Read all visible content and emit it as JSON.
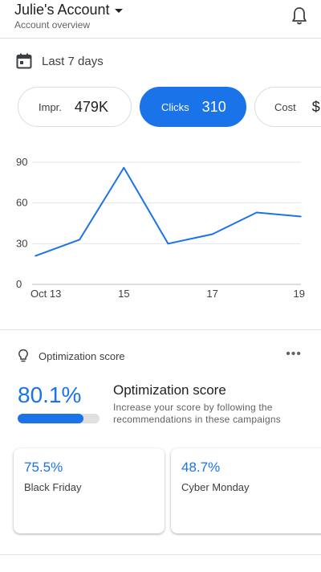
{
  "header": {
    "account_name": "Julie's Account",
    "account_sub": "Account overview",
    "bell_icon": "notifications-bell-icon"
  },
  "date_range": {
    "icon": "calendar-icon",
    "label": "Last 7 days"
  },
  "metrics": [
    {
      "label": "Impr.",
      "value": "479K",
      "selected": false
    },
    {
      "label": "Clicks",
      "value": "310",
      "selected": true
    },
    {
      "label": "Cost",
      "value": "$",
      "selected": false
    }
  ],
  "colors": {
    "accent": "#1a73e8",
    "text": "#202124",
    "muted": "#5f6368",
    "border": "#dadce0"
  },
  "chart_data": {
    "type": "line",
    "x": [
      "Oct 13",
      "14",
      "15",
      "16",
      "17",
      "18",
      "19"
    ],
    "x_tick_labels": [
      "Oct 13",
      "15",
      "17",
      "19"
    ],
    "y_tick_labels": [
      "0",
      "30",
      "60",
      "90"
    ],
    "ylim": [
      0,
      90
    ],
    "grid": true,
    "series": [
      {
        "values": [
          21,
          33,
          86,
          30,
          37,
          53,
          50
        ]
      }
    ]
  },
  "optimization": {
    "header_label": "Optimization score",
    "icon": "lightbulb-icon",
    "more_icon": "more-horizontal-icon",
    "more_label": "•••",
    "score": "80.1%",
    "score_fraction": 0.801,
    "title": "Optimization score",
    "description": "Increase your score by following the recommendations in these campaigns"
  },
  "campaigns": [
    {
      "score": "75.5%",
      "name": "Black Friday"
    },
    {
      "score": "48.7%",
      "name": "Cyber Monday"
    }
  ]
}
